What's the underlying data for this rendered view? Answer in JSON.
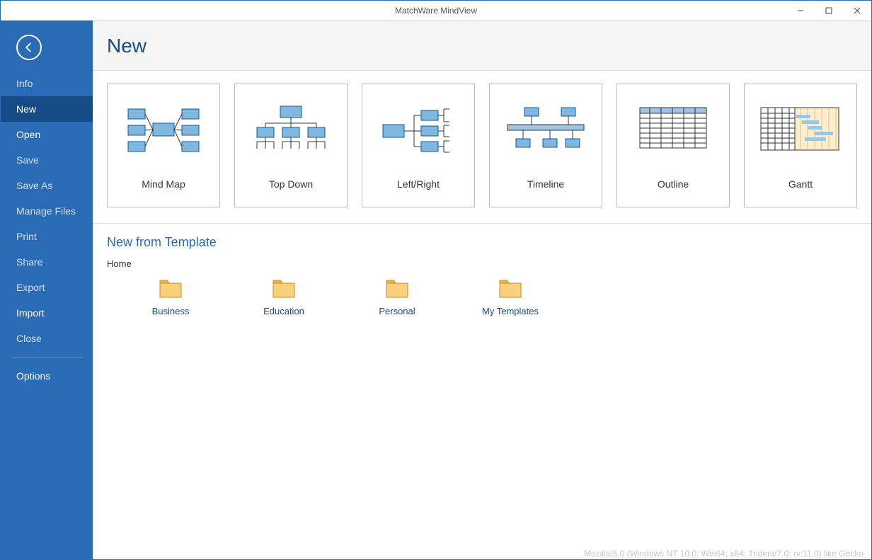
{
  "window": {
    "title": "MatchWare MindView"
  },
  "sidebar": {
    "items": [
      {
        "label": "Info",
        "enabled": false
      },
      {
        "label": "New",
        "enabled": true,
        "selected": true
      },
      {
        "label": "Open",
        "enabled": true
      },
      {
        "label": "Save",
        "enabled": false
      },
      {
        "label": "Save As",
        "enabled": false
      },
      {
        "label": "Manage Files",
        "enabled": false
      },
      {
        "label": "Print",
        "enabled": false
      },
      {
        "label": "Share",
        "enabled": false
      },
      {
        "label": "Export",
        "enabled": false
      },
      {
        "label": "Import",
        "enabled": true
      },
      {
        "label": "Close",
        "enabled": false
      }
    ],
    "options": "Options"
  },
  "page": {
    "title": "New",
    "templates": [
      {
        "label": "Mind Map"
      },
      {
        "label": "Top Down"
      },
      {
        "label": "Left/Right"
      },
      {
        "label": "Timeline"
      },
      {
        "label": "Outline"
      },
      {
        "label": "Gantt"
      }
    ],
    "section_title": "New from Template",
    "breadcrumb": "Home",
    "folders": [
      {
        "label": "Business"
      },
      {
        "label": "Education"
      },
      {
        "label": "Personal"
      },
      {
        "label": "My Templates"
      }
    ]
  },
  "status": "Mozilla/5.0 (Windows NT 10.0; Win64; x64; Trident/7.0; rv:11.0) like Gecko"
}
